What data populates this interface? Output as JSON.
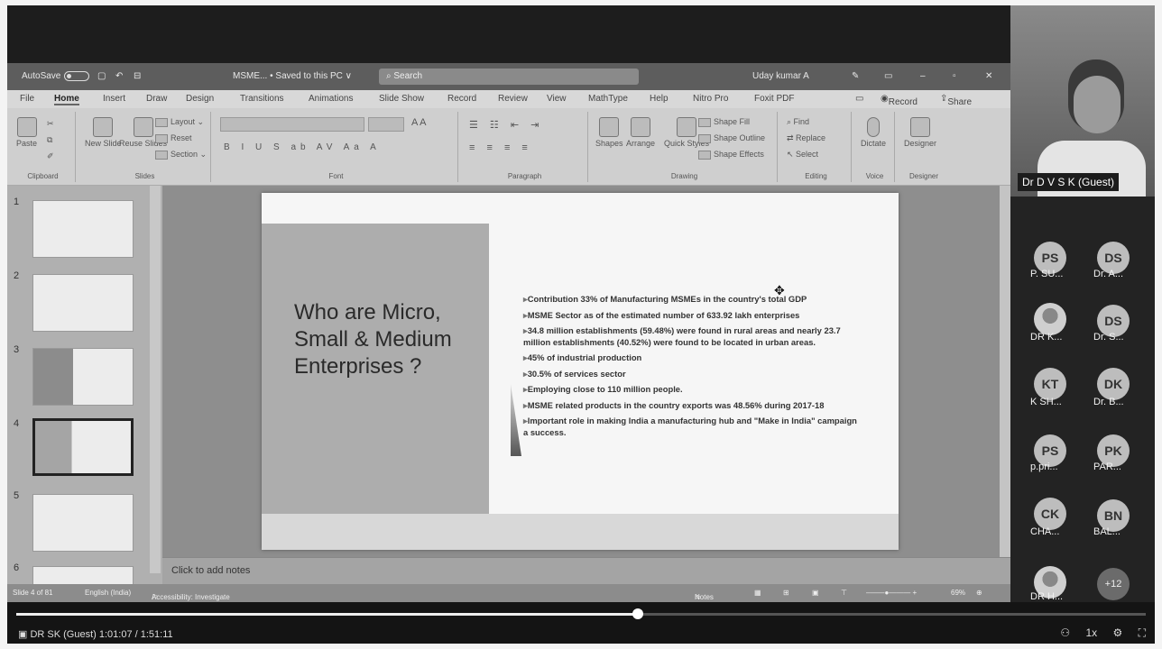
{
  "powerpoint": {
    "titlebar": {
      "autosave": "AutoSave",
      "toggle": "Off",
      "filename": "MSME... • Saved to this PC ∨",
      "search": "Search",
      "user": "Uday kumar A"
    },
    "menu_tabs": [
      "File",
      "Home",
      "Insert",
      "Draw",
      "Design",
      "Transitions",
      "Animations",
      "Slide Show",
      "Record",
      "Review",
      "View",
      "MathType",
      "Help",
      "Nitro Pro",
      "Foxit PDF"
    ],
    "menu_right": {
      "record": "Record",
      "share": "Share"
    },
    "ribbon": {
      "clipboard": {
        "label": "Clipboard",
        "paste": "Paste"
      },
      "slides": {
        "label": "Slides",
        "new_slide": "New Slide",
        "reuse": "Reuse Slides",
        "layout": "Layout",
        "reset": "Reset",
        "section": "Section"
      },
      "font": {
        "label": "Font"
      },
      "paragraph": {
        "label": "Paragraph"
      },
      "drawing": {
        "label": "Drawing",
        "shapes": "Shapes",
        "arrange": "Arrange",
        "quick_styles": "Quick Styles",
        "shape_fill": "Shape Fill",
        "shape_outline": "Shape Outline",
        "shape_effects": "Shape Effects"
      },
      "editing": {
        "label": "Editing",
        "find": "Find",
        "replace": "Replace",
        "select": "Select"
      },
      "voice": {
        "label": "Voice",
        "dictate": "Dictate"
      },
      "designer": {
        "label": "Designer",
        "designer": "Designer"
      }
    },
    "slide_numbers": [
      "1",
      "2",
      "3",
      "4",
      "5",
      "6"
    ],
    "slide": {
      "title": "Who are Micro, Small & Medium Enterprises ?",
      "bullets": [
        "Contribution 33%  of Manufacturing MSMEs in the country's total GDP",
        "MSME Sector as of the estimated number of 633.92 lakh enterprises",
        "34.8 million establishments (59.48%) were found in rural areas and nearly 23.7 million establishments (40.52%) were found to be located in urban areas.",
        "45% of industrial production",
        "30.5% of services sector",
        "Employing close to 110 million people.",
        "MSME related products in the country exports was 48.56% during 2017-18",
        "Important role in making India a manufacturing hub and \"Make in India\" campaign a success."
      ]
    },
    "notes_placeholder": "Click to add notes",
    "status": {
      "slide_count": "Slide 4 of 81",
      "language": "English (India)",
      "accessibility": "Accessibility: Investigate",
      "notes": "Notes",
      "zoom": "69%"
    }
  },
  "meeting": {
    "presenter_label": "Dr D V S K (Guest)",
    "participants": [
      {
        "initials": "PS",
        "name": "P. SU..."
      },
      {
        "initials": "DS",
        "name": "Dr. A..."
      },
      {
        "initials": "",
        "name": "DR K..."
      },
      {
        "initials": "DS",
        "name": "Dr. S..."
      },
      {
        "initials": "KT",
        "name": "K SH..."
      },
      {
        "initials": "DK",
        "name": "Dr. B..."
      },
      {
        "initials": "PS",
        "name": "p.pri..."
      },
      {
        "initials": "PK",
        "name": "PAR..."
      },
      {
        "initials": "CK",
        "name": "CHA..."
      },
      {
        "initials": "BN",
        "name": "BAL..."
      },
      {
        "initials": "",
        "name": "DR H..."
      }
    ],
    "more": "+12"
  },
  "player": {
    "label": "DR SK (Guest)",
    "time": "1:01:07 / 1:51:11",
    "progress": 0.55,
    "speed": "1x"
  }
}
